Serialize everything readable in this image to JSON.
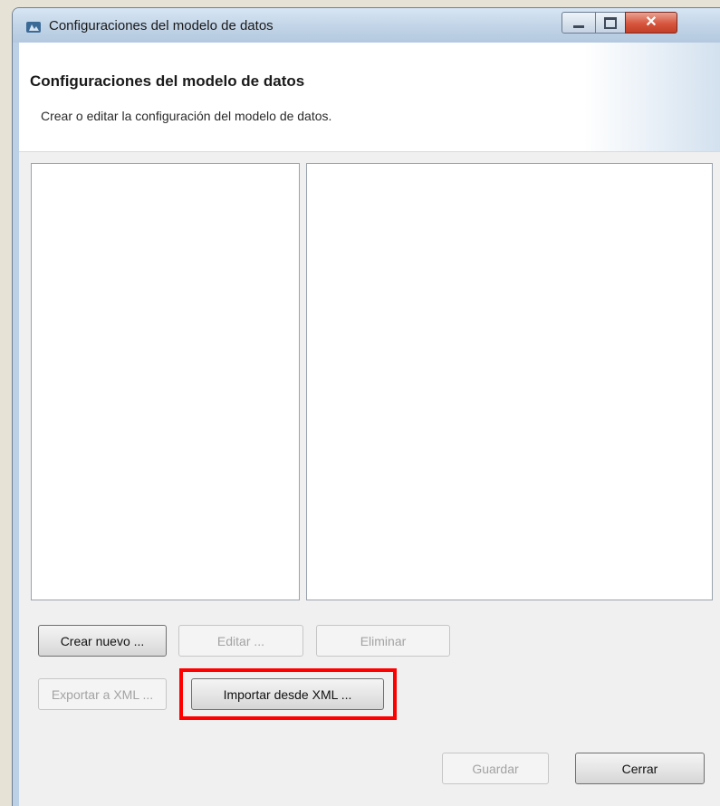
{
  "window": {
    "title": "Configuraciones del modelo de datos",
    "close_glyph": "✕"
  },
  "header": {
    "title": "Configuraciones del modelo de datos",
    "description": "Crear o editar la configuración del modelo de datos."
  },
  "buttons": {
    "create_new": "Crear nuevo ...",
    "edit": "Editar ...",
    "delete": "Eliminar",
    "export_xml": "Exportar a XML ...",
    "import_xml": "Importar desde XML ...",
    "save": "Guardar",
    "close": "Cerrar"
  },
  "icons": {
    "app": "app-icon",
    "minimize": "minimize-icon",
    "maximize": "maximize-icon",
    "close": "close-icon"
  },
  "colors": {
    "highlight": "#ff0000",
    "close_button": "#d7553d"
  }
}
